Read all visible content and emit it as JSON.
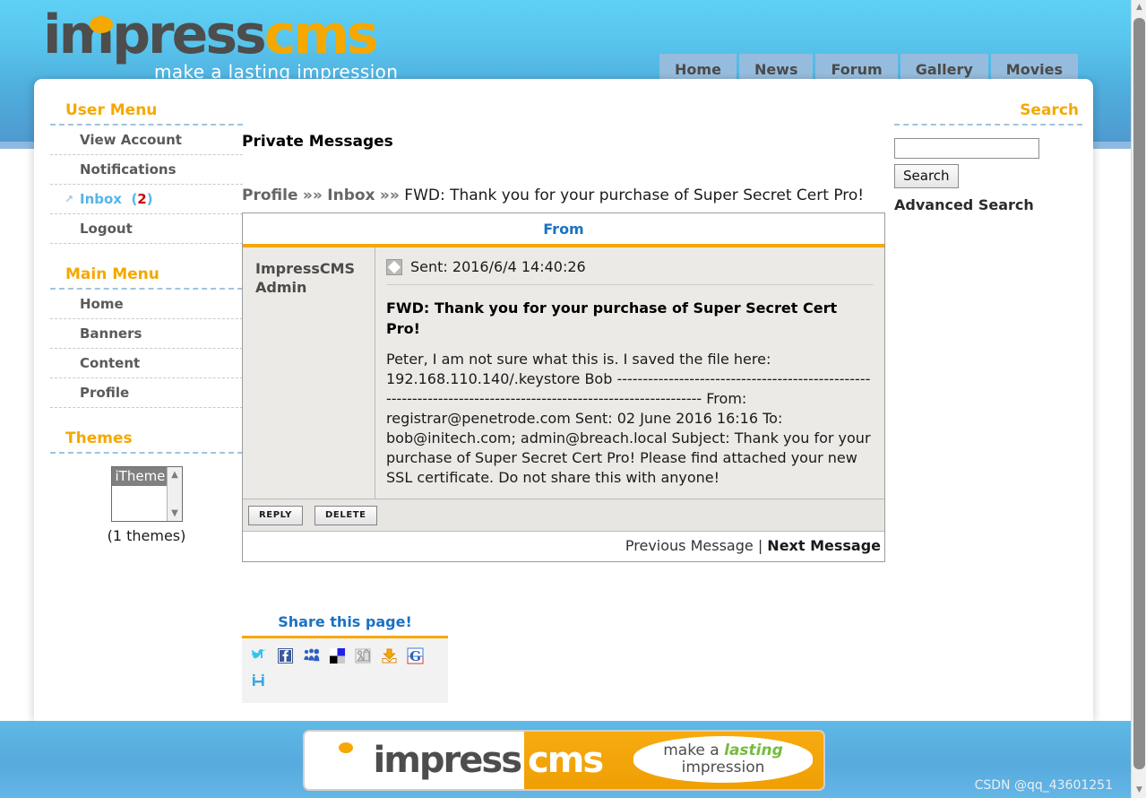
{
  "header": {
    "logo_impress": "impress",
    "logo_cms": "cms",
    "logo_tagline": "make a lasting impression",
    "nav": [
      {
        "label": "Home"
      },
      {
        "label": "News"
      },
      {
        "label": "Forum"
      },
      {
        "label": "Gallery"
      },
      {
        "label": "Movies"
      }
    ]
  },
  "sidebar": {
    "user_menu": {
      "title": "User Menu",
      "items": [
        {
          "label": "View Account"
        },
        {
          "label": "Notifications"
        },
        {
          "label": "Inbox",
          "count": "(2)",
          "count_value": "2",
          "active": true
        },
        {
          "label": "Logout"
        }
      ]
    },
    "main_menu": {
      "title": "Main Menu",
      "items": [
        {
          "label": "Home"
        },
        {
          "label": "Banners"
        },
        {
          "label": "Content"
        },
        {
          "label": "Profile"
        }
      ]
    },
    "themes": {
      "title": "Themes",
      "selected": "iTheme",
      "count_label": "(1 themes)"
    }
  },
  "content": {
    "page_title": "Private Messages",
    "breadcrumb": {
      "crumb1": "Profile",
      "sep1": "»»",
      "crumb2": "Inbox",
      "sep2": "»»",
      "current": "FWD: Thank you for your purchase of Super Secret Cert Pro!"
    },
    "message": {
      "from_header": "From",
      "sender": "ImpressCMS Admin",
      "sent": "Sent: 2016/6/4 14:40:26",
      "subject": "FWD: Thank you for your purchase of Super Secret Cert Pro!",
      "body": "Peter, I am not sure what this is. I saved the file here: 192.168.110.140/.keystore Bob -------------------------------------------------------------------------------------------------------------- From: registrar@penetrode.com Sent: 02 June 2016 16:16 To: bob@initech.com; admin@breach.local Subject: Thank you for your purchase of Super Secret Cert Pro! Please find attached your new SSL certificate. Do not share this with anyone!",
      "reply_label": "REPLY",
      "delete_label": "DELETE",
      "prev_label": "Previous Message",
      "nav_separator": "|",
      "next_label": "Next Message"
    }
  },
  "share": {
    "title": "Share this page!",
    "icons": [
      {
        "name": "twitter-icon"
      },
      {
        "name": "facebook-icon"
      },
      {
        "name": "myspace-icon"
      },
      {
        "name": "delicious-icon"
      },
      {
        "name": "digg-icon"
      },
      {
        "name": "download-icon"
      },
      {
        "name": "google-icon"
      },
      {
        "name": "identica-icon"
      }
    ]
  },
  "search": {
    "title": "Search",
    "input_value": "",
    "button_label": "Search",
    "advanced_label": "Advanced Search"
  },
  "footer": {
    "banner_impress": "impress",
    "banner_cms": "cms",
    "banner_line1_a": "make a ",
    "banner_line1_b": "lasting",
    "banner_line2": "impression",
    "watermark": "CSDN @qq_43601251"
  },
  "colors": {
    "accent_orange": "#f5a800",
    "link_blue": "#1b72c4",
    "active_blue": "#57b4e8",
    "alert_red": "#cc0000",
    "header_blue": "#58c6ee"
  }
}
